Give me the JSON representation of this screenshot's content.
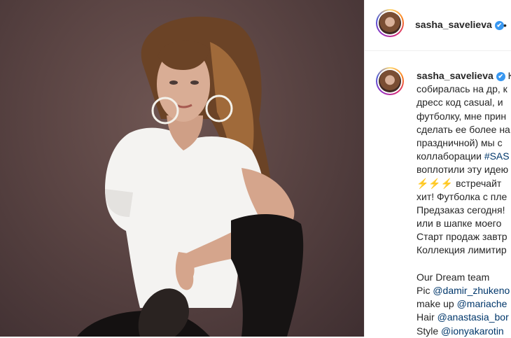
{
  "post": {
    "username": "sasha_savelieva",
    "verified_icon": "✔",
    "more_icon": "•"
  },
  "caption": {
    "first_word": "К",
    "lines": [
      "собиралась на др, к",
      "дресс код casual, и",
      "футболку, мне прин",
      "сделать ее более на",
      "праздничной) мы с",
      "коллаборации "
    ],
    "hashtag": "#SAS",
    "lines2": [
      "воплотили эту идею"
    ],
    "bolts": "⚡⚡⚡",
    "bolt_text": " встречайт",
    "lines3": [
      "хит! Футболка с пле",
      "Предзаказ сегодня!",
      "или в шапке моего",
      "Старт продаж завтр",
      "Коллекция лимитир",
      "",
      "Our Dream team"
    ],
    "credits": [
      {
        "label": "Pic ",
        "tag": "@damir_zhukeno"
      },
      {
        "label": "make up ",
        "tag": "@mariache"
      },
      {
        "label": "Hair ",
        "tag": "@anastasia_bor"
      },
      {
        "label": "Style ",
        "tag": "@ionyakarotin"
      }
    ]
  }
}
